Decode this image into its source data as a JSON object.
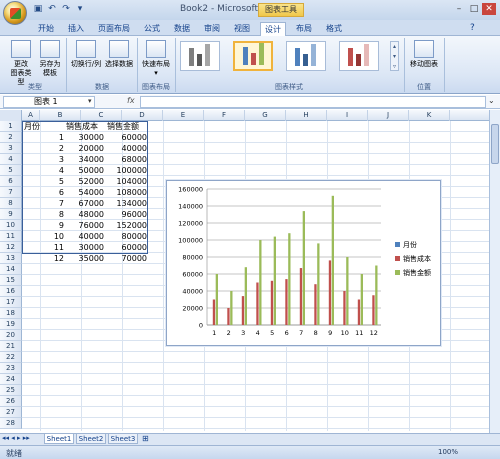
{
  "window": {
    "title": "Book2 - Microsoft Excel",
    "chart_tools_label": "图表工具",
    "controls": {
      "minimize": "–",
      "maximize": "□",
      "close": "✕"
    }
  },
  "tabs": [
    "开始",
    "插入",
    "页面布局",
    "公式",
    "数据",
    "审阅",
    "视图",
    "设计",
    "布局",
    "格式"
  ],
  "active_tab": "设计",
  "ribbon": {
    "groups": {
      "type": {
        "label": "类型",
        "buttons": [
          "更改\n图表类型",
          "另存为\n模板"
        ]
      },
      "data": {
        "label": "数据",
        "buttons": [
          "切换行/列",
          "选择数据"
        ]
      },
      "layout": {
        "label": "图表布局",
        "buttons": [
          "快速布局"
        ]
      },
      "styles": {
        "label": "图表样式"
      },
      "location": {
        "label": "位置",
        "buttons": [
          "移动图表"
        ]
      }
    }
  },
  "formula_bar": {
    "name_box": "图表 1",
    "fx": "fx",
    "value": ""
  },
  "columns": [
    "A",
    "B",
    "C",
    "D",
    "E",
    "F",
    "G",
    "H",
    "I",
    "J",
    "K"
  ],
  "rows": [
    "1",
    "2",
    "3",
    "4",
    "5",
    "6",
    "7",
    "8",
    "9",
    "10",
    "11",
    "12",
    "13",
    "14",
    "15",
    "16",
    "17",
    "18",
    "19",
    "20",
    "21",
    "22",
    "23",
    "24",
    "25",
    "26",
    "27",
    "28"
  ],
  "table": {
    "headers": [
      "月份",
      "销售成本",
      "销售金额"
    ],
    "rows": [
      [
        "1",
        "30000",
        "60000"
      ],
      [
        "2",
        "20000",
        "40000"
      ],
      [
        "3",
        "34000",
        "68000"
      ],
      [
        "4",
        "50000",
        "100000"
      ],
      [
        "5",
        "52000",
        "104000"
      ],
      [
        "6",
        "54000",
        "108000"
      ],
      [
        "7",
        "67000",
        "134000"
      ],
      [
        "8",
        "48000",
        "96000"
      ],
      [
        "9",
        "76000",
        "152000"
      ],
      [
        "10",
        "40000",
        "80000"
      ],
      [
        "11",
        "30000",
        "60000"
      ],
      [
        "12",
        "35000",
        "70000"
      ]
    ]
  },
  "sheets": [
    "Sheet1",
    "Sheet2",
    "Sheet3"
  ],
  "active_sheet": "Sheet1",
  "status": {
    "text": "就绪",
    "zoom": "100%"
  },
  "colors": {
    "series1": "#4f81bd",
    "series2": "#c0504d",
    "series3": "#9bbb59"
  },
  "chart_data": {
    "type": "bar",
    "categories": [
      "1",
      "2",
      "3",
      "4",
      "5",
      "6",
      "7",
      "8",
      "9",
      "10",
      "11",
      "12"
    ],
    "series": [
      {
        "name": "月份",
        "values": [
          1,
          2,
          3,
          4,
          5,
          6,
          7,
          8,
          9,
          10,
          11,
          12
        ]
      },
      {
        "name": "销售成本",
        "values": [
          30000,
          20000,
          34000,
          50000,
          52000,
          54000,
          67000,
          48000,
          76000,
          40000,
          30000,
          35000
        ]
      },
      {
        "name": "销售金额",
        "values": [
          60000,
          40000,
          68000,
          100000,
          104000,
          108000,
          134000,
          96000,
          152000,
          80000,
          60000,
          70000
        ]
      }
    ],
    "ylim": [
      0,
      160000
    ],
    "yticks": [
      "0",
      "20000",
      "40000",
      "60000",
      "80000",
      "100000",
      "120000",
      "140000",
      "160000"
    ],
    "grid": true,
    "legend": "right"
  }
}
